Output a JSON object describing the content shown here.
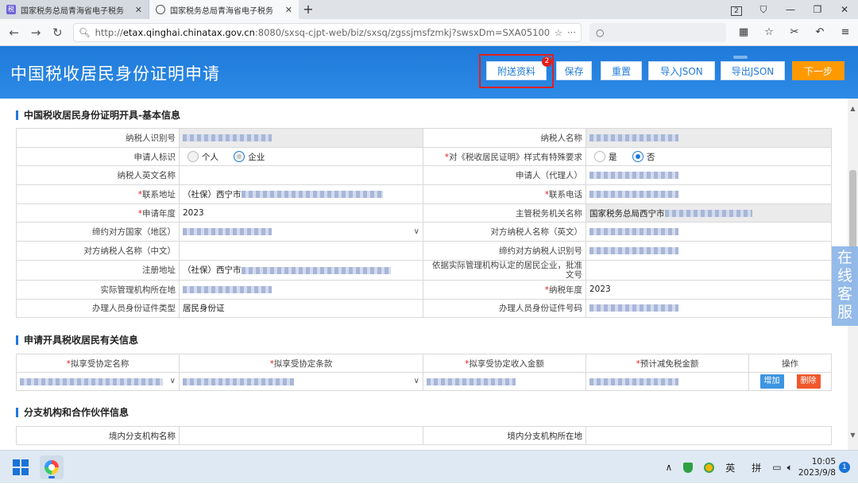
{
  "browser": {
    "tabs": [
      {
        "title": "国家税务总局青海省电子税务",
        "active": false
      },
      {
        "title": "国家税务总局青海省电子税务",
        "active": true
      }
    ],
    "url_prefix": "http://",
    "url_host": "etax.qinghai.chinatax.gov.cn",
    "url_rest": ":8080/sxsq-cjpt-web/biz/sxsq/zgssjmsfzmkj?swsxDm=SXA05100!",
    "tab_count_badge": "2"
  },
  "header": {
    "title": "中国税收居民身份证明申请",
    "buttons": {
      "attach": "附送资料",
      "save": "保存",
      "reset": "重置",
      "import_json": "导入JSON",
      "export_json": "导出JSON",
      "next": "下一步"
    },
    "attach_badge": "2"
  },
  "section_basic": {
    "title": "中国税收居民身份证明开具-基本信息",
    "rows": [
      {
        "l1": "纳税人识别号",
        "r1": "",
        "v1_ro": true,
        "l2": "纳税人名称",
        "r2": "",
        "v2_ro": true
      },
      {
        "l1": "申请人标识",
        "r1": "",
        "l2": "对《税收居民证明》样式有特殊要求",
        "r2": "*"
      },
      {
        "l1": "纳税人英文名称",
        "r1": "",
        "l2": "申请人（代理人）",
        "r2": ""
      },
      {
        "l1": "联系地址",
        "r1": "*",
        "l2": "联系电话",
        "r2": "*"
      },
      {
        "l1": "申请年度",
        "r1": "*",
        "l2": "主管税务机关名称",
        "r2": ""
      },
      {
        "l1": "缔约对方国家（地区）",
        "r1": "",
        "l2": "对方纳税人名称（英文）",
        "r2": ""
      },
      {
        "l1": "对方纳税人名称（中文）",
        "r1": "",
        "l2": "缔约对方纳税人识别号",
        "r2": ""
      },
      {
        "l1": "注册地址",
        "r1": "",
        "l2": "依据实际管理机构认定的居民企业，批准文号",
        "r2": ""
      },
      {
        "l1": "实际管理机构所在地",
        "r1": "",
        "l2": "纳税年度",
        "r2": "*"
      },
      {
        "l1": "办理人员身份证件类型",
        "r1": "",
        "l2": "办理人员身份证件号码",
        "r2": ""
      }
    ],
    "values": {
      "applicant_opt1": "个人",
      "applicant_opt2": "企业",
      "special_yes": "是",
      "special_no": "否",
      "address_prefix": "（社保）西宁市",
      "apply_year": "2023",
      "tax_office_prefix": "国家税务总局西宁市",
      "reg_address_prefix": "（社保）西宁市",
      "tax_year": "2023",
      "id_type": "居民身份证"
    }
  },
  "section_tax": {
    "title": "申请开具税收居民有关信息",
    "headers": [
      "拟享受协定名称",
      "拟享受协定条款",
      "拟享受协定收入金额",
      "预计减免税金额",
      "操作"
    ],
    "add_label": "增加",
    "delete_label": "删除"
  },
  "section_branch": {
    "title": "分支机构和合作伙伴信息",
    "headers": [
      "境内分支机构名称",
      "境内分支机构所在地"
    ]
  },
  "floating": {
    "service": "在线客服"
  },
  "taskbar": {
    "ime_lang": "英",
    "ime_mode": "拼",
    "time": "10:05",
    "date": "2023/9/8",
    "notifications": "1"
  },
  "colors": {
    "header_blue": "#1f7ad9",
    "next_orange": "#ff9900",
    "highlight_red": "#e3201b",
    "delete_red": "#f0572c"
  }
}
